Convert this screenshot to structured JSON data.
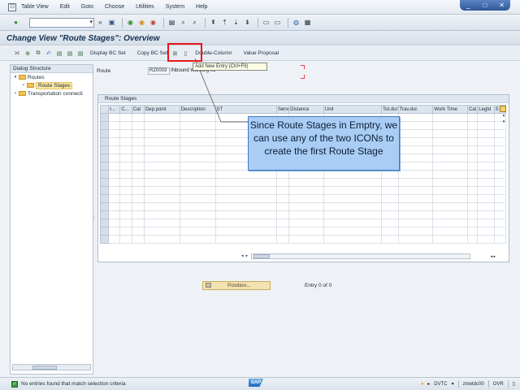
{
  "menu": [
    "Table View",
    "Edit",
    "Goto",
    "Choose",
    "Utilities",
    "System",
    "Help"
  ],
  "menu_underline": [
    "T",
    "E",
    "G",
    "C",
    "U",
    "S",
    "H"
  ],
  "window_controls": [
    "_",
    "□",
    "✕"
  ],
  "page_title": "Change View \"Route Stages\": Overview",
  "app_toolbar": {
    "display_bc_set": "Display BC Set",
    "copy_bc_set": "Copy BC Set",
    "double_column": "Double-Column",
    "value_proposal": "Value Proposal"
  },
  "tooltip": "Add New Entry    (Ctrl+F9)",
  "dialog_structure": {
    "title": "Dialog Structure",
    "items": [
      {
        "label": "Routes",
        "level": 0,
        "twist": "▾"
      },
      {
        "label": "Route Stages",
        "level": 1,
        "twist": "•"
      },
      {
        "label": "Transportation connecti",
        "level": 0,
        "twist": "•"
      }
    ]
  },
  "route": {
    "label": "Route",
    "value": "RZ0003",
    "description": "INbound                    Warburg 03"
  },
  "stages": {
    "title": "Route Stages",
    "columns": [
      "I...",
      "C...",
      "Cat",
      "Dep.point",
      "Description",
      "ST",
      "ServcAgent",
      "Distance",
      "Unit",
      "Tot.durat.",
      "Trav.dur.",
      "Work Time",
      "Cal",
      "LegId",
      "S"
    ]
  },
  "callout": "Since Route Stages in Emptry, we can use any of the two ICONs to create the first Route Stage",
  "position_button": "Position...",
  "entry_text": "Entry 0 of 0",
  "status": {
    "message": "No entries found that match selection criteria",
    "logo": "SAP",
    "system": "DVTC",
    "user": "zmetdc00",
    "mode": "OVR"
  }
}
